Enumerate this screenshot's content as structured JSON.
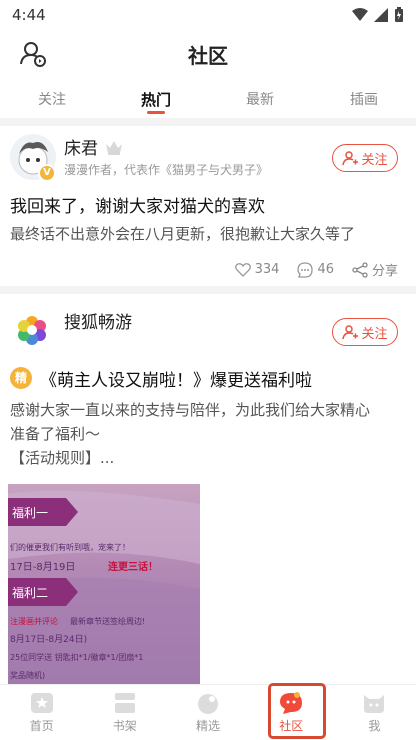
{
  "status_bar": {
    "time": "4:44"
  },
  "header": {
    "title": "社区"
  },
  "tabs": [
    {
      "label": "关注"
    },
    {
      "label": "热门"
    },
    {
      "label": "最新"
    },
    {
      "label": "插画"
    }
  ],
  "post1": {
    "author": "床君",
    "verified_badge": "V",
    "subtitle": "漫漫作者，代表作《猫男子与犬男子》",
    "follow_label": "关注",
    "title": "我回来了，谢谢大家对猫犬的喜欢",
    "body": "最终话不出意外会在八月更新，很抱歉让大家久等了",
    "likes": "334",
    "comments": "46",
    "share_label": "分享"
  },
  "post2": {
    "author": "搜狐畅游",
    "follow_label": "关注",
    "tag": "精",
    "title": "《萌主人设又崩啦！》爆更送福利啦",
    "body_line1": "感谢大家一直以来的支持与陪伴，为此我们给大家精心",
    "body_line2": "准备了福利～",
    "body_line3": "【活动规则】...",
    "image": {
      "label1": "福利一",
      "line1": "们的催更我们有听到哦，宠来了！",
      "date1": "17日-8月19日",
      "highlight1": "连更三话！",
      "label2": "福利二",
      "line2a": "注漫画并评论",
      "line2b": "最新章节送签绘周边!",
      "date2": "8月17日-8月24日)",
      "line3": "25位同学送 钥匙扣*1/徽章*1/团扇*1",
      "line4": "奖品随机)"
    }
  },
  "bottom_nav": [
    {
      "label": "首页"
    },
    {
      "label": "书架"
    },
    {
      "label": "精选"
    },
    {
      "label": "社区"
    },
    {
      "label": "我"
    }
  ],
  "colors": {
    "accent": "#e8533f",
    "muted": "#999999"
  }
}
